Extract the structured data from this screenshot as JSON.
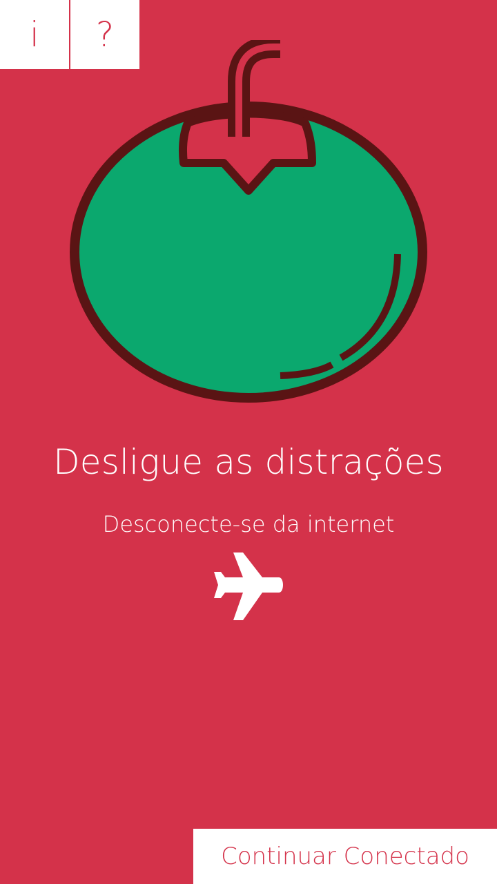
{
  "header": {
    "info_label": "i",
    "help_label": "?"
  },
  "main": {
    "title": "Desligue as distrações",
    "subtitle": "Desconecte-se da internet",
    "airplane_icon": "airplane-icon",
    "illustration_icon": "tomato-icon"
  },
  "footer": {
    "continue_label": "Continuar Conectado"
  },
  "colors": {
    "background": "#D4324A",
    "tomato_green": "#0BA86E",
    "outline": "#5A1414",
    "white": "#FFFFFF"
  }
}
